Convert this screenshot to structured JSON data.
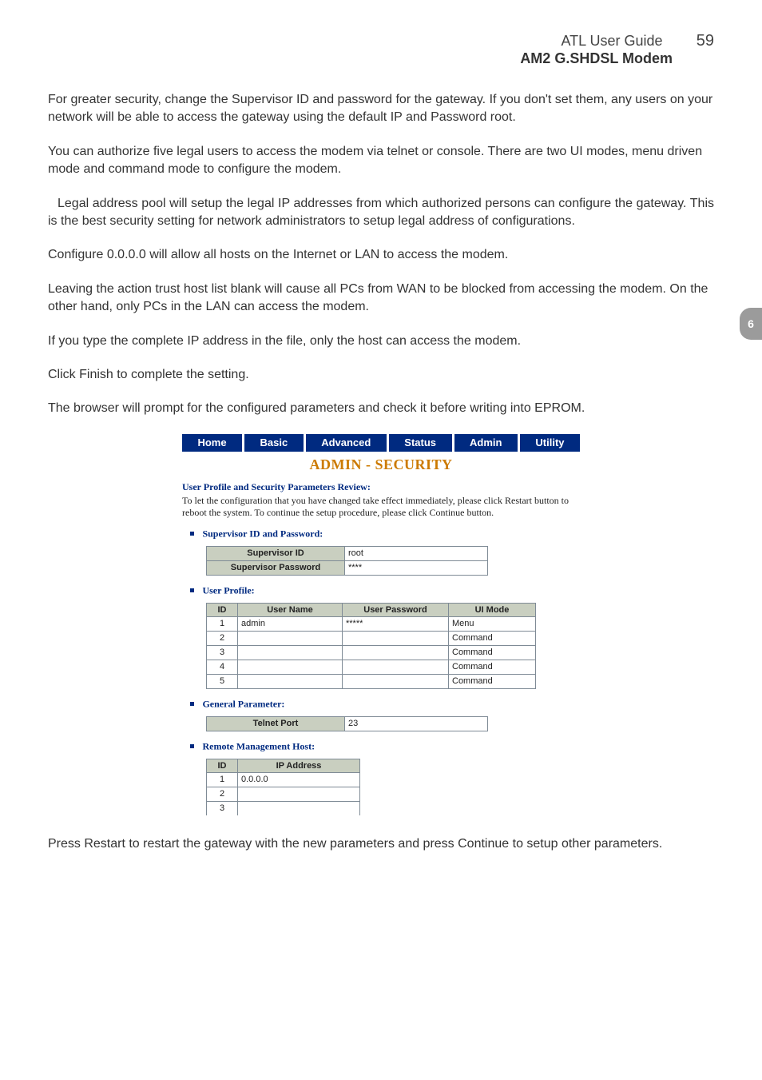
{
  "header": {
    "title": "ATL User Guide",
    "page_number": "59",
    "subtitle": "AM2 G.SHDSL Modem"
  },
  "side_tab": "6",
  "paragraphs": {
    "p1": "For greater security, change the Supervisor ID and password for the gateway. If you don't set them, any users on your network will be able to access the gateway using the default IP and Password root.",
    "p2": "You can authorize five legal users to access the modem via telnet or console. There are two UI modes, menu driven mode and command mode to configure the modem.",
    "p3": "Legal address pool will setup the legal IP addresses from which authorized persons can configure the gateway. This is the best security setting for network administrators to setup legal address of configurations.",
    "p4": "Configure 0.0.0.0 will allow all hosts on the Internet or LAN to access the modem.",
    "p5": "Leaving the action trust host list blank will cause all PCs from WAN to be blocked from accessing the modem. On the other hand, only PCs in the LAN can access the modem.",
    "p6": "If you type the complete IP address in the file, only the host can access the modem.",
    "p7": "Click Finish to complete the setting.",
    "p8": "The browser will prompt for the configured parameters and check it before writing into EPROM.",
    "p_end": "Press Restart to restart the gateway with the new parameters and press Continue to setup other parameters."
  },
  "shot": {
    "nav": [
      "Home",
      "Basic",
      "Advanced",
      "Status",
      "Admin",
      "Utility"
    ],
    "title": "ADMIN - SECURITY",
    "review_label": "User Profile and Security Parameters Review:",
    "review_text": "To let the configuration that you have changed take effect immediately, please click Restart button to reboot the system. To continue the setup procedure, please click Continue button.",
    "sections": {
      "sup": "Supervisor ID and Password:",
      "up": "User Profile:",
      "gp": "General Parameter:",
      "rh": "Remote Management Host:"
    },
    "supervisor": {
      "id_label": "Supervisor ID",
      "id_value": "root",
      "pw_label": "Supervisor Password",
      "pw_value": "****"
    },
    "user_profile": {
      "headers": {
        "id": "ID",
        "name": "User Name",
        "pw": "User Password",
        "mode": "UI Mode"
      },
      "rows": [
        {
          "id": "1",
          "name": "admin",
          "pw": "*****",
          "mode": "Menu"
        },
        {
          "id": "2",
          "name": "",
          "pw": "",
          "mode": "Command"
        },
        {
          "id": "3",
          "name": "",
          "pw": "",
          "mode": "Command"
        },
        {
          "id": "4",
          "name": "",
          "pw": "",
          "mode": "Command"
        },
        {
          "id": "5",
          "name": "",
          "pw": "",
          "mode": "Command"
        }
      ]
    },
    "general": {
      "telnet_label": "Telnet Port",
      "telnet_value": "23"
    },
    "remote_hosts": {
      "headers": {
        "id": "ID",
        "ip": "IP Address"
      },
      "rows": [
        {
          "id": "1",
          "ip": "0.0.0.0"
        },
        {
          "id": "2",
          "ip": ""
        },
        {
          "id": "3",
          "ip": ""
        }
      ]
    }
  }
}
